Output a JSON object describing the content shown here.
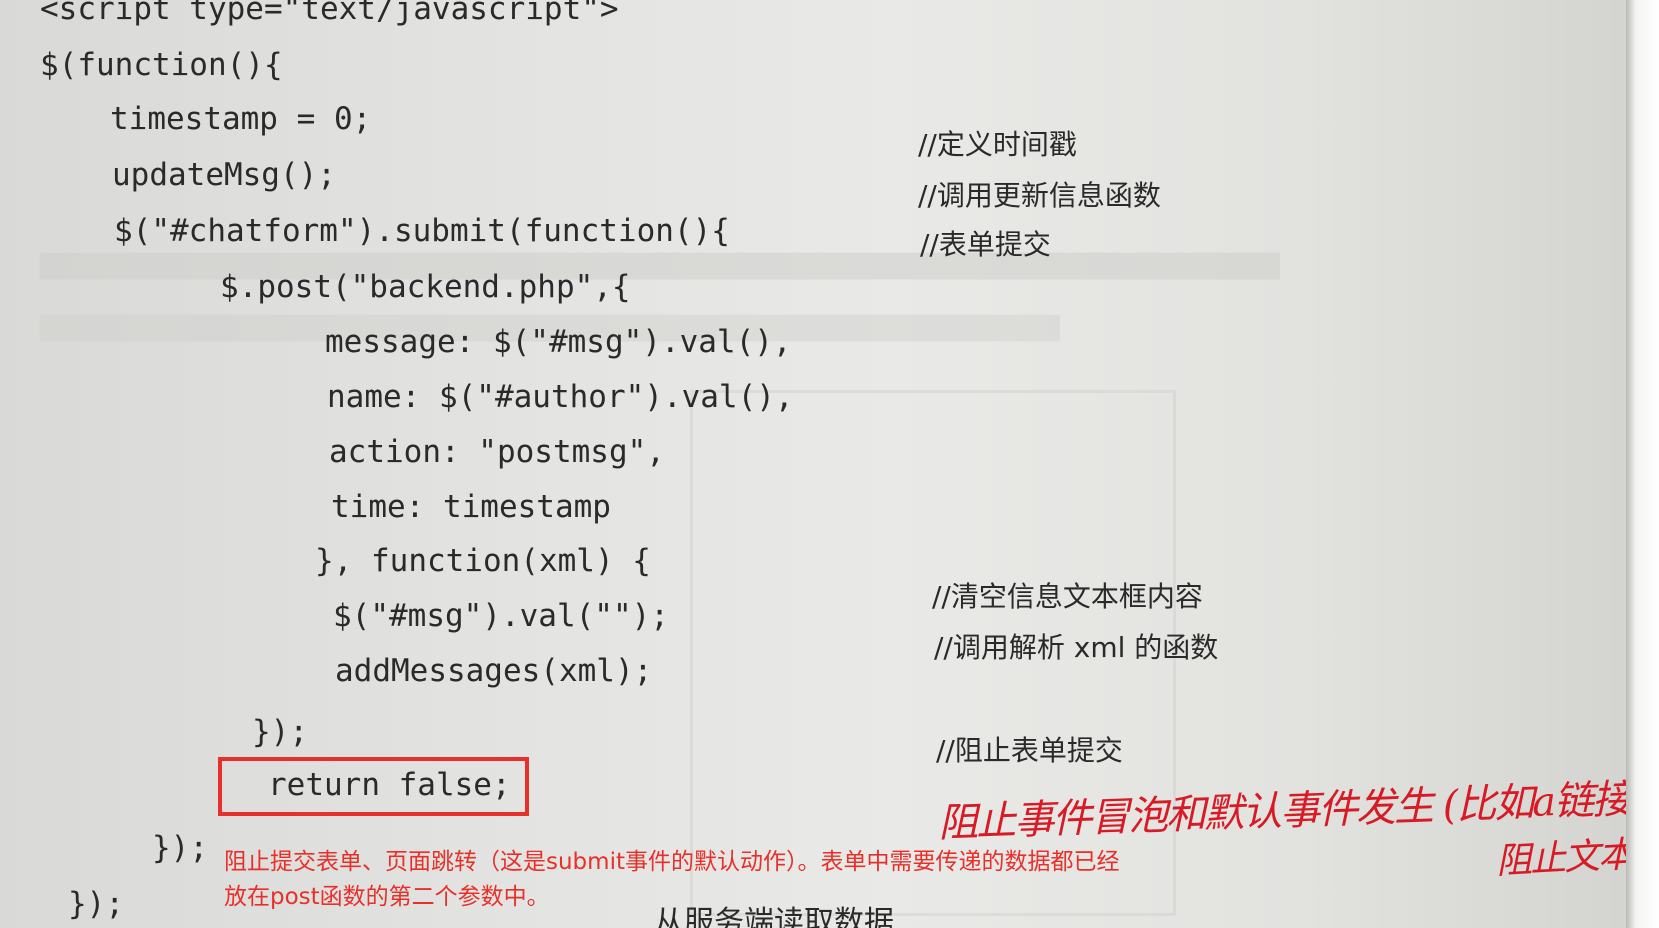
{
  "code_lines": [
    "<script type=\"text/javascript\">",
    "$(function(){",
    "timestamp = 0;",
    "updateMsg();",
    "$(\"#chatform\").submit(function(){",
    "$.post(\"backend.php\",{",
    "message: $(\"#msg\").val(),",
    "name: $(\"#author\").val(),",
    "action: \"postmsg\",",
    "time: timestamp",
    "}, function(xml) {",
    "$(\"#msg\").val(\"\");",
    "addMessages(xml);",
    "});",
    "return false;",
    "});",
    "});"
  ],
  "comments": [
    "//定义时间戳",
    "//调用更新信息函数",
    "//表单提交",
    "//清空信息文本框内容",
    "//调用解析 xml 的函数",
    "//阻止表单提交"
  ],
  "annotation": {
    "line1": "阻止提交表单、页面跳转（这是submit事件的默认动作）。表单中需要传递的数据都已经",
    "line2": "放在post函数的第二个参数中。"
  },
  "handwritten": {
    "line1": "阻止事件冒泡和默认事件发生 (比如a链接跳转)",
    "line2": "阻止文本框"
  },
  "bottom_text": "从服务端读取数据",
  "colors": {
    "annotation_red": "#e8302a",
    "handwriting_red": "#d81a25",
    "page_gray": "#e4e4e2",
    "ink": "#2a2a2a"
  }
}
